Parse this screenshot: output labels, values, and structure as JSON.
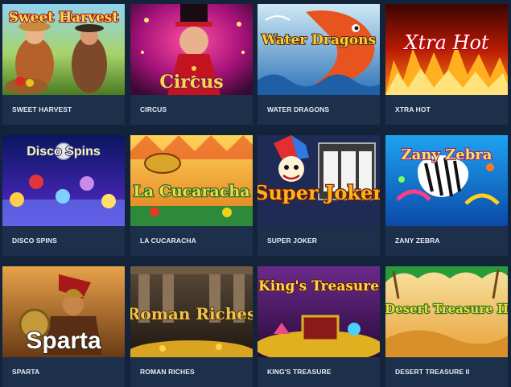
{
  "games": [
    {
      "title": "SWEET HARVEST",
      "logo": "Sweet Harvest"
    },
    {
      "title": "CIRCUS",
      "logo": "Circus"
    },
    {
      "title": "WATER DRAGONS",
      "logo": "Water Dragons"
    },
    {
      "title": "XTRA HOT",
      "logo": "Xtra Hot"
    },
    {
      "title": "DISCO SPINS",
      "logo": "Disco Spins"
    },
    {
      "title": "LA CUCARACHA",
      "logo": "La Cucaracha"
    },
    {
      "title": "SUPER JOKER",
      "logo": "Super Joker"
    },
    {
      "title": "ZANY ZEBRA",
      "logo": "Zany Zebra"
    },
    {
      "title": "SPARTA",
      "logo": "Sparta"
    },
    {
      "title": "ROMAN RICHES",
      "logo": "Roman Riches"
    },
    {
      "title": "KING'S TREASURE",
      "logo": "King's Treasure"
    },
    {
      "title": "DESERT TREASURE II",
      "logo": "Desert Treasure II"
    }
  ],
  "colors": {
    "page_bg": "#13233a",
    "card_bg": "#1c2f4b",
    "caption_text": "#e6ecf5"
  }
}
